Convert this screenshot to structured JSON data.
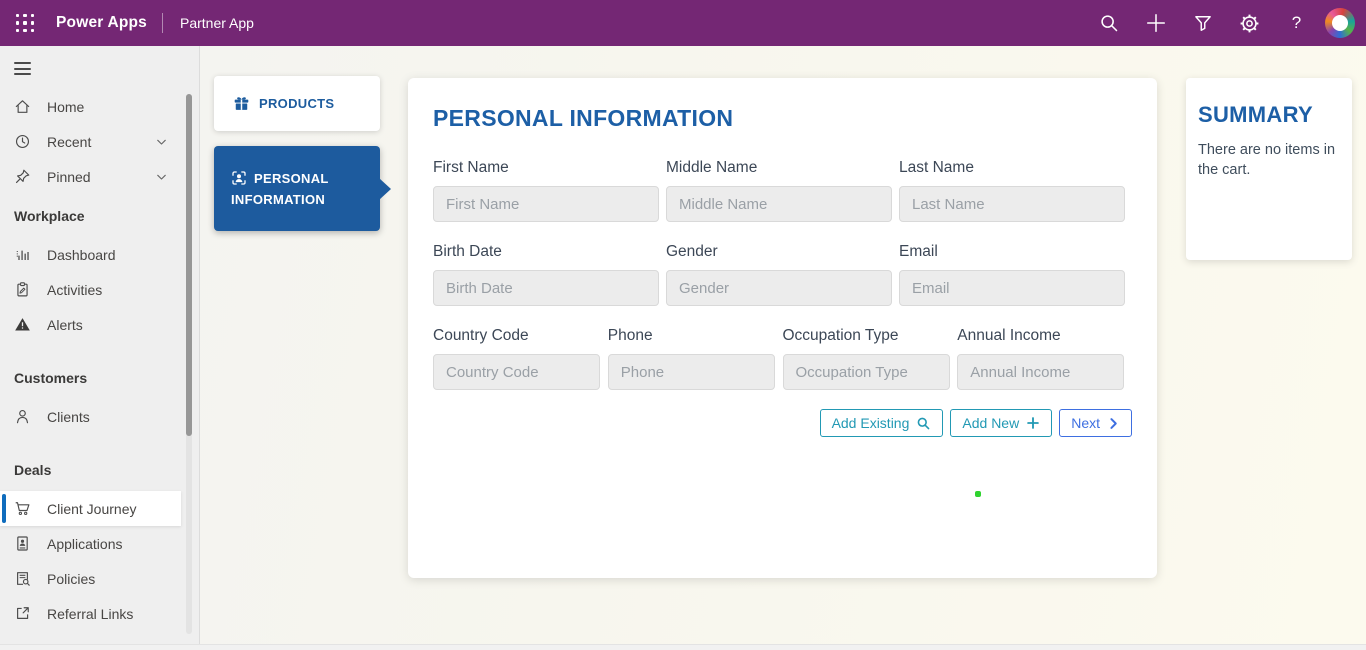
{
  "header": {
    "brand": "Power Apps",
    "app_title": "Partner App",
    "help_glyph": "?",
    "icons": [
      "app-launcher-icon",
      "search-icon",
      "plus-icon",
      "filter-icon",
      "gear-icon",
      "help-icon",
      "avatar"
    ]
  },
  "sidebar": {
    "top_items": [
      {
        "label": "Home",
        "icon": "home-icon"
      },
      {
        "label": "Recent",
        "icon": "clock-icon",
        "expandable": true
      },
      {
        "label": "Pinned",
        "icon": "pin-icon",
        "expandable": true
      }
    ],
    "sections": [
      {
        "title": "Workplace",
        "items": [
          {
            "label": "Dashboard",
            "icon": "dashboard-icon"
          },
          {
            "label": "Activities",
            "icon": "clipboard-icon"
          },
          {
            "label": "Alerts",
            "icon": "alert-triangle-icon"
          }
        ]
      },
      {
        "title": "Customers",
        "items": [
          {
            "label": "Clients",
            "icon": "person-icon"
          }
        ]
      },
      {
        "title": "Deals",
        "items": [
          {
            "label": "Client Journey",
            "icon": "cart-icon",
            "selected": true
          },
          {
            "label": "Applications",
            "icon": "id-card-icon"
          },
          {
            "label": "Policies",
            "icon": "document-search-icon"
          },
          {
            "label": "Referral Links",
            "icon": "external-link-icon"
          }
        ]
      }
    ]
  },
  "tabs": [
    {
      "label": "PRODUCTS",
      "icon": "gift-icon",
      "selected": false
    },
    {
      "label": "PERSONAL INFORMATION",
      "icon": "person-badge-icon",
      "selected": true
    }
  ],
  "form": {
    "title": "PERSONAL INFORMATION",
    "rows": [
      [
        {
          "label": "First Name",
          "placeholder": "First Name",
          "value": ""
        },
        {
          "label": "Middle Name",
          "placeholder": "Middle Name",
          "value": ""
        },
        {
          "label": "Last Name",
          "placeholder": "Last Name",
          "value": ""
        }
      ],
      [
        {
          "label": "Birth Date",
          "placeholder": "Birth Date",
          "value": ""
        },
        {
          "label": "Gender",
          "placeholder": "Gender",
          "value": ""
        },
        {
          "label": "Email",
          "placeholder": "Email",
          "value": ""
        }
      ],
      [
        {
          "label": "Country Code",
          "placeholder": "Country Code",
          "value": ""
        },
        {
          "label": "Phone",
          "placeholder": "Phone",
          "value": ""
        },
        {
          "label": "Occupation Type",
          "placeholder": "Occupation Type",
          "value": ""
        },
        {
          "label": "Annual Income",
          "placeholder": "Annual Income",
          "value": ""
        }
      ]
    ],
    "buttons": [
      {
        "label": "Add Existing",
        "icon": "search-icon"
      },
      {
        "label": "Add New",
        "icon": "plus-icon"
      },
      {
        "label": "Next",
        "icon": "chevron-right-icon"
      }
    ]
  },
  "summary": {
    "title": "SUMMARY",
    "message": "There are no items in the cart."
  },
  "colors": {
    "header_bg": "#742774",
    "tab_blue": "#1d5b9e",
    "heading_blue": "#1d5fa6",
    "teal_button": "#2299b4",
    "next_blue": "#3e6fe1",
    "selected_bar_blue": "#0f6cbd",
    "green_dot": "#2fd32f",
    "sidebar_bg": "#efefef",
    "input_bg": "#ececec"
  }
}
